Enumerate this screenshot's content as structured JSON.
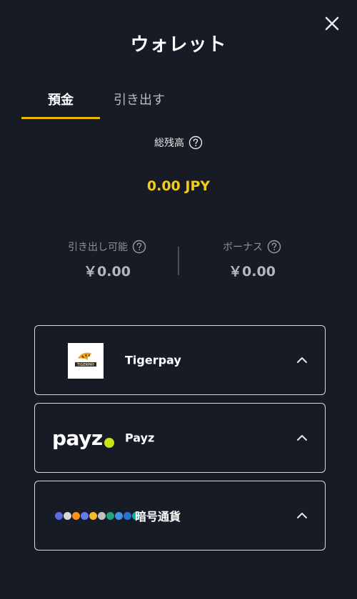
{
  "header": {
    "title": "ウォレット",
    "close_icon": "close-icon"
  },
  "tabs": [
    {
      "label": "預金",
      "active": true
    },
    {
      "label": "引き出す",
      "active": false
    }
  ],
  "total": {
    "label": "総残高",
    "amount": "0.00 JPY"
  },
  "balances": {
    "withdrawable": {
      "label": "引き出し可能",
      "value": "￥0.00"
    },
    "bonus": {
      "label": "ボーナス",
      "value": "￥0.00"
    }
  },
  "methods": [
    {
      "name": "Tigerpay",
      "logo_icon": "tigerpay-logo-icon"
    },
    {
      "name": "Payz",
      "logo_text": "payz",
      "logo_icon": "payz-logo-icon"
    },
    {
      "name": "暗号通貨",
      "logo_icon": "crypto-coins-logo-icon"
    }
  ],
  "colors": {
    "background": "#171b26",
    "accent": "#e6b800",
    "amount": "#f2cd17",
    "payz_dot": "#c6e417"
  }
}
